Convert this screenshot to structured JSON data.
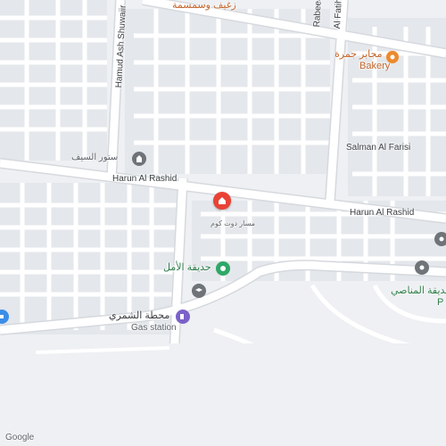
{
  "map": {
    "streets": {
      "harun_left": "Harun Al Rashid",
      "harun_right": "Harun Al Rashid",
      "salman": "Salman Al Farisi",
      "hamud": "Hamud Ash Shuwaiir",
      "rabeea": "Rabeea",
      "alfatih": "Al Fatih"
    },
    "pois": {
      "bakery_ar": "زغيف وسمسمة",
      "majar_ar": "مجابر جمرة",
      "majar_en": "Bakery",
      "saif_ar": "ستور السيف",
      "selected_sub": "مسار دوت كوم",
      "park_ar": "حديقة الأمل",
      "gas_ar": "محطة الشمري",
      "gas_en": "Gas station",
      "mahasi_ar": "حديقة المناصي",
      "mahasi_sub": "P"
    },
    "colors": {
      "land": "#eef0f3",
      "block": "#e4e7eb",
      "road": "#ffffff",
      "road_edge": "#d5d9de",
      "pin_red": "#e94235",
      "pin_orange": "#ee8a2c",
      "pin_green": "#2fa866",
      "pin_gray": "#6f7479",
      "pin_purple": "#7b62c9",
      "pin_blue": "#3b8ee8"
    },
    "footer": {
      "logo": "Google"
    }
  }
}
